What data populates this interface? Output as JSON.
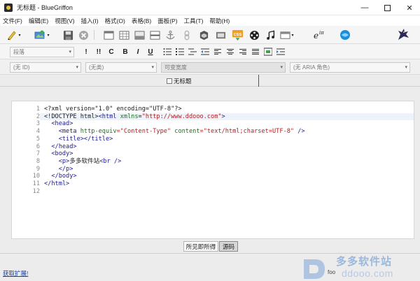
{
  "window": {
    "title": "无标题 - BlueGriffon",
    "minimize_label": "—",
    "close_label": "✕"
  },
  "menu": {
    "items": [
      {
        "label": "文件(F)"
      },
      {
        "label": "编辑(E)"
      },
      {
        "label": "视图(V)"
      },
      {
        "label": "插入(I)"
      },
      {
        "label": "格式(O)"
      },
      {
        "label": "表格(B)"
      },
      {
        "label": "面板(P)"
      },
      {
        "label": "工具(T)"
      },
      {
        "label": "帮助(H)"
      }
    ]
  },
  "toolbar": {
    "icons": [
      "new-document-icon",
      "open-image-icon",
      "save-icon",
      "stop-icon",
      "layout-icon",
      "table-icon",
      "form-icon",
      "anchor-icon",
      "link-icon",
      "image-icon",
      "css-icon",
      "film-icon",
      "music-icon",
      "html5-icon",
      "math-icon",
      "web-globe-icon",
      "griffon-logo-icon"
    ],
    "css_label": "CSS",
    "math_label": "eⁱπ"
  },
  "format_bar": {
    "paragraph_value": "段落",
    "buttons": {
      "important": "!",
      "double_important": "!!",
      "code": "C",
      "bold": "B",
      "italic": "I",
      "underline": "U"
    }
  },
  "attributes_bar": {
    "id_value": "(无 ID)",
    "class_value": "(无类)",
    "width_value": "可变宽度",
    "aria_value": "(无 ARIA 角色)"
  },
  "tabs": [
    {
      "label": "无标题",
      "active": true
    }
  ],
  "editor": {
    "line_numbers": [
      "1",
      "2",
      "3",
      "4",
      "5",
      "6",
      "7",
      "8",
      "9",
      "10",
      "11",
      "12"
    ],
    "active_line": 2,
    "code": {
      "l1": "<?xml version=\"1.0\" encoding=\"UTF-8\"?>",
      "l2_doctype": "<!DOCTYPE html>",
      "l2_tag": "<html ",
      "l2_attr": "xmlns",
      "l2_eq": "=",
      "l2_val": "\"http://www.ddooo.com\"",
      "l2_close": ">",
      "l3": "  <head>",
      "l4_open": "    <meta ",
      "l4_a1": "http-equiv",
      "l4_v1": "=\"Content-Type\"",
      "l4_a2": " content",
      "l4_v2": "=\"text/html;charset=UTF-8\"",
      "l4_close": " />",
      "l5": "    <title></title>",
      "l6": "  </head>",
      "l7": "  <body>",
      "l8_tag": "    <p>",
      "l8_text": "多多软件站",
      "l8_br": "<br />",
      "l9": "    </p>",
      "l10": "  </body>",
      "l11": "</html>",
      "l12": ""
    }
  },
  "view_toggle": {
    "wysiwyg_label": "所见即所得",
    "source_label": "源码",
    "selected": "源码"
  },
  "status": {
    "link_label": "获取扩展!",
    "right_text": "foo"
  },
  "watermark": {
    "site_name": "多多软件站",
    "url": "ddooo.com"
  },
  "colors": {
    "accent_blue": "#1a8fd8",
    "tag_color": "#1a1a8c",
    "attr_color": "#1b6f1b",
    "string_color": "#b02020"
  }
}
